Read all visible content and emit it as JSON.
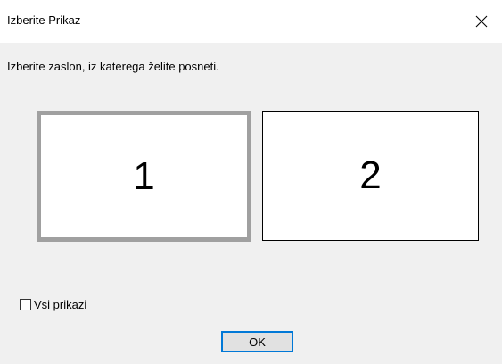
{
  "window": {
    "title": "Izberite Prikaz",
    "close_icon": "close-icon"
  },
  "dialog": {
    "instruction": "Izberite zaslon, iz katerega želite posneti.",
    "monitors": [
      {
        "label": "1",
        "selected": true
      },
      {
        "label": "2",
        "selected": false
      }
    ],
    "all_displays_checkbox": {
      "label": "Vsi prikazi",
      "checked": false
    },
    "ok_label": "OK"
  },
  "colors": {
    "client_background": "#f0f0f0",
    "selected_border": "#a0a0a0",
    "button_focus_border": "#0078d7"
  }
}
